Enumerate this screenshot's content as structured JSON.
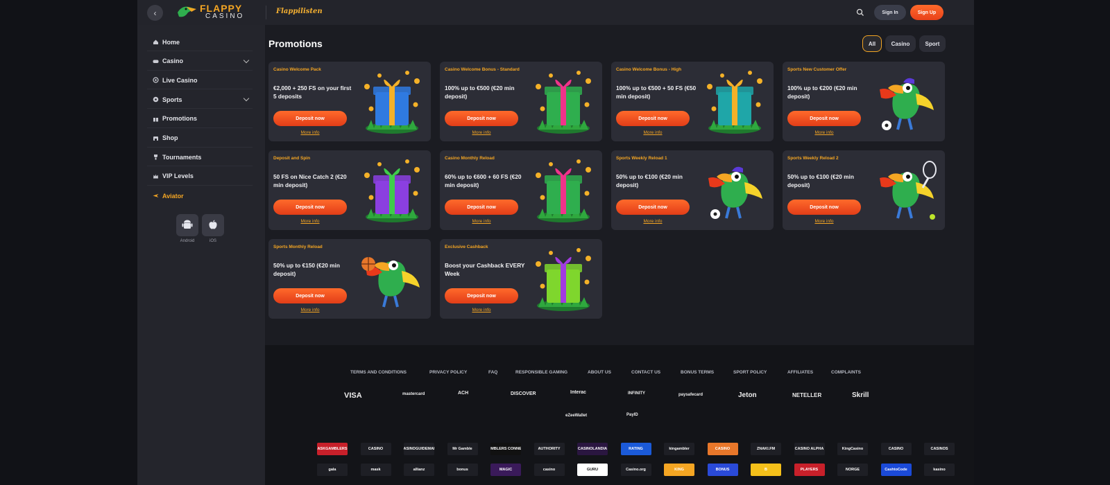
{
  "header": {
    "back_icon": "chevron-left-icon",
    "logo_line1": "FLAPPY",
    "logo_line2": "CASINO",
    "brand_script": "Flappilisten",
    "sign_in": "Sign In",
    "sign_up": "Sign Up"
  },
  "sidebar": {
    "items": [
      {
        "label": "Home",
        "icon": "home-icon"
      },
      {
        "label": "Casino",
        "icon": "gamepad-icon"
      },
      {
        "label": "Live Casino",
        "icon": "live-icon"
      },
      {
        "label": "Sports",
        "icon": "sports-icon"
      },
      {
        "label": "Promotions",
        "icon": "gift-icon"
      },
      {
        "label": "Shop",
        "icon": "shop-icon"
      },
      {
        "label": "Tournaments",
        "icon": "trophy-icon"
      },
      {
        "label": "VIP Levels",
        "icon": "crown-icon"
      },
      {
        "label": "Aviator",
        "icon": "plane-icon"
      }
    ],
    "apps": [
      {
        "label": "Android"
      },
      {
        "label": "iOS"
      }
    ]
  },
  "main": {
    "title": "Promotions",
    "filters": [
      {
        "label": "All",
        "active": true
      },
      {
        "label": "Casino",
        "active": false
      },
      {
        "label": "Sport",
        "active": false
      }
    ],
    "cards": [
      {
        "title": "Casino Welcome Pack",
        "desc": "€2,000 + 250 FS on your first 5 deposits",
        "button": "Deposit now",
        "link": "More info",
        "art": "gift-blue"
      },
      {
        "title": "Casino Welcome Bonus - Standard",
        "desc": "100% up to €500 (€20 min deposit)",
        "button": "Deposit now",
        "link": "More info",
        "art": "gift-green-pink"
      },
      {
        "title": "Casino Welcome Bonus - High",
        "desc": "100% up to €500 + 50 FS (€50 min deposit)",
        "button": "Deposit now",
        "link": "More info",
        "art": "gift-teal-gold"
      },
      {
        "title": "Sports New Customer Offer",
        "desc": "100% up to €200 (€20 min deposit)",
        "button": "Deposit now",
        "link": "More info",
        "art": "toucan-football"
      },
      {
        "title": "Deposit and Spin",
        "desc": "50 FS on Nice Catch 2 (€20 min deposit)",
        "button": "Deposit now",
        "link": "More info",
        "art": "gift-purple"
      },
      {
        "title": "Casino Monthly Reload",
        "desc": "60% up to €600 + 60 FS (€20 min deposit)",
        "button": "Deposit now",
        "link": "More info",
        "art": "gift-green-pink"
      },
      {
        "title": "Sports Weekly Reload 1",
        "desc": "50% up to €100 (€20 min deposit)",
        "button": "Deposit now",
        "link": "More info",
        "art": "toucan-football"
      },
      {
        "title": "Sports Weekly Reload 2",
        "desc": "50% up to €100 (€20 min deposit)",
        "button": "Deposit now",
        "link": "More info",
        "art": "toucan-tennis"
      },
      {
        "title": "Sports Monthly Reload",
        "desc": "50% up to €150 (€20 min deposit)",
        "button": "Deposit now",
        "link": "More info",
        "art": "toucan-basketball"
      },
      {
        "title": "Exclusive Cashback",
        "desc": "Boost your Cashback EVERY Week",
        "button": "Deposit now",
        "link": "More info",
        "art": "gift-lime"
      }
    ]
  },
  "footer": {
    "links": [
      "TERMS AND CONDITIONS",
      "PRIVACY POLICY",
      "FAQ",
      "RESPONSIBLE GAMING",
      "ABOUT US",
      "CONTACT US",
      "BONUS TERMS",
      "SPORT POLICY",
      "AFFILIATES",
      "COMPLAINTS"
    ],
    "payments": [
      "VISA",
      "mastercard",
      "ACH",
      "DISCOVER",
      "Interac",
      "INFINITY",
      "paysafecard",
      "Jeton",
      "NETELLER",
      "Skrill",
      "eZeeWallet",
      "PayID"
    ],
    "badges_row1": [
      "ASKGAMBLERS",
      "CASINO",
      "CASINOGUIDEMAIN",
      "Mr Gamble",
      "GAMBLERS CONNECT",
      "AUTHORITY",
      "CASINOLANDIA",
      "RATING",
      "kingambler",
      "CASINO",
      "ZNAKI.FM",
      "CASINO ALPHA",
      "KingCasino",
      "CASINO",
      "CASINOS"
    ],
    "badges_row2": [
      "gala",
      "mask",
      "allianz",
      "bonus",
      "MAGIC",
      "casino",
      "GURU",
      "Casino.org",
      "KING",
      "BONUS",
      "B",
      "PLAYERS",
      "NORGE",
      "CashtoCode",
      "kasino"
    ],
    "colors": {
      "accent": "#f5a623",
      "cta": "#f0501f",
      "card": "#2c2d36",
      "sidebar": "#24252c"
    }
  }
}
